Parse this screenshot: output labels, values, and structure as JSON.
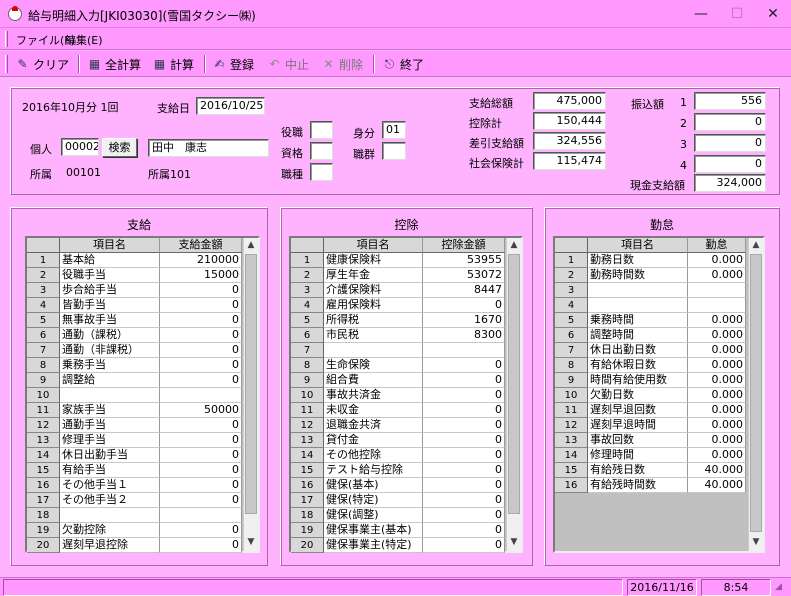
{
  "window": {
    "title": "給与明細入力[JKI03030](雪国タクシー㈱)"
  },
  "menu": [
    "ファイル(F)",
    "編集(E)"
  ],
  "toolbar": {
    "clear": "クリア",
    "recalc_all": "全計算",
    "calc": "計算",
    "register": "登録",
    "cancel": "中止",
    "delete": "削除",
    "exit": "終了"
  },
  "header": {
    "period": "2016年10月分 1回",
    "payday_label": "支給日",
    "payday": "2016/10/25",
    "person_label": "個人",
    "person_code": "00002",
    "search_button": "検索",
    "person_name": "田中　康志",
    "dept_label": "所属",
    "dept_code": "00101",
    "dept_name": "所属101",
    "position_label": "役職",
    "qualification_label": "資格",
    "job_label": "職種",
    "status_label": "身分",
    "status_value": "01",
    "job_group_label": "職群"
  },
  "totals": {
    "pay_total_label": "支給総額",
    "pay_total": "475,000",
    "deduct_total_label": "控除計",
    "deduct_total": "150,444",
    "net_label": "差引支給額",
    "net": "324,556",
    "social_label": "社会保険計",
    "social": "115,474",
    "transfer_label": "振込額",
    "transfers": [
      {
        "no": "1",
        "value": "556"
      },
      {
        "no": "2",
        "value": "0"
      },
      {
        "no": "3",
        "value": "0"
      },
      {
        "no": "4",
        "value": "0"
      }
    ],
    "cash_label": "現金支給額",
    "cash": "324,000"
  },
  "pay": {
    "title": "支給",
    "col_name": "項目名",
    "col_value": "支給金額",
    "rows": [
      {
        "no": "1",
        "name": "基本給",
        "value": "210000"
      },
      {
        "no": "2",
        "name": "役職手当",
        "value": "15000"
      },
      {
        "no": "3",
        "name": "歩合給手当",
        "value": "0"
      },
      {
        "no": "4",
        "name": "皆勤手当",
        "value": "0"
      },
      {
        "no": "5",
        "name": "無事故手当",
        "value": "0"
      },
      {
        "no": "6",
        "name": "通勤（課税）",
        "value": "0"
      },
      {
        "no": "7",
        "name": "通勤（非課税）",
        "value": "0"
      },
      {
        "no": "8",
        "name": "乗務手当",
        "value": "0"
      },
      {
        "no": "9",
        "name": "調整給",
        "value": "0"
      },
      {
        "no": "10",
        "name": "",
        "value": ""
      },
      {
        "no": "11",
        "name": "家族手当",
        "value": "50000"
      },
      {
        "no": "12",
        "name": "通勤手当",
        "value": "0"
      },
      {
        "no": "13",
        "name": "修理手当",
        "value": "0"
      },
      {
        "no": "14",
        "name": "休日出勤手当",
        "value": "0"
      },
      {
        "no": "15",
        "name": "有給手当",
        "value": "0"
      },
      {
        "no": "16",
        "name": "その他手当１",
        "value": "0"
      },
      {
        "no": "17",
        "name": "その他手当２",
        "value": "0"
      },
      {
        "no": "18",
        "name": "",
        "value": ""
      },
      {
        "no": "19",
        "name": "欠勤控除",
        "value": "0"
      },
      {
        "no": "20",
        "name": "遅刻早退控除",
        "value": "0"
      }
    ]
  },
  "deduction": {
    "title": "控除",
    "col_name": "項目名",
    "col_value": "控除金額",
    "rows": [
      {
        "no": "1",
        "name": "健康保険料",
        "value": "53955"
      },
      {
        "no": "2",
        "name": "厚生年金",
        "value": "53072"
      },
      {
        "no": "3",
        "name": "介護保険料",
        "value": "8447"
      },
      {
        "no": "4",
        "name": "雇用保険料",
        "value": "0"
      },
      {
        "no": "5",
        "name": "所得税",
        "value": "1670"
      },
      {
        "no": "6",
        "name": "市民税",
        "value": "8300"
      },
      {
        "no": "7",
        "name": "",
        "value": ""
      },
      {
        "no": "8",
        "name": "生命保険",
        "value": "0"
      },
      {
        "no": "9",
        "name": "組合費",
        "value": "0"
      },
      {
        "no": "10",
        "name": "事故共済金",
        "value": "0"
      },
      {
        "no": "11",
        "name": "未収金",
        "value": "0"
      },
      {
        "no": "12",
        "name": "退職金共済",
        "value": "0"
      },
      {
        "no": "13",
        "name": "貸付金",
        "value": "0"
      },
      {
        "no": "14",
        "name": "その他控除",
        "value": "0"
      },
      {
        "no": "15",
        "name": "テスト給与控除",
        "value": "0"
      },
      {
        "no": "16",
        "name": "健保(基本)",
        "value": "0"
      },
      {
        "no": "17",
        "name": "健保(特定)",
        "value": "0"
      },
      {
        "no": "18",
        "name": "健保(調整)",
        "value": "0"
      },
      {
        "no": "19",
        "name": "健保事業主(基本)",
        "value": "0"
      },
      {
        "no": "20",
        "name": "健保事業主(特定)",
        "value": "0"
      }
    ]
  },
  "attendance": {
    "title": "勤怠",
    "col_name": "項目名",
    "col_value": "勤怠",
    "rows": [
      {
        "no": "1",
        "name": "勤務日数",
        "value": "0.000"
      },
      {
        "no": "2",
        "name": "勤務時間数",
        "value": "0.000"
      },
      {
        "no": "3",
        "name": "",
        "value": ""
      },
      {
        "no": "4",
        "name": "",
        "value": ""
      },
      {
        "no": "5",
        "name": "乗務時間",
        "value": "0.000"
      },
      {
        "no": "6",
        "name": "調整時間",
        "value": "0.000"
      },
      {
        "no": "7",
        "name": "休日出勤日数",
        "value": "0.000"
      },
      {
        "no": "8",
        "name": "有給休暇日数",
        "value": "0.000"
      },
      {
        "no": "9",
        "name": "時間有給使用数",
        "value": "0.000"
      },
      {
        "no": "10",
        "name": "欠勤日数",
        "value": "0.000"
      },
      {
        "no": "11",
        "name": "遅刻早退回数",
        "value": "0.000"
      },
      {
        "no": "12",
        "name": "遅刻早退時間",
        "value": "0.000"
      },
      {
        "no": "13",
        "name": "事故回数",
        "value": "0.000"
      },
      {
        "no": "14",
        "name": "修理時間",
        "value": "0.000"
      },
      {
        "no": "15",
        "name": "有給残日数",
        "value": "40.000"
      },
      {
        "no": "16",
        "name": "有給残時間数",
        "value": "40.000"
      }
    ]
  },
  "statusbar": {
    "date": "2016/11/16",
    "time": "8:54"
  }
}
